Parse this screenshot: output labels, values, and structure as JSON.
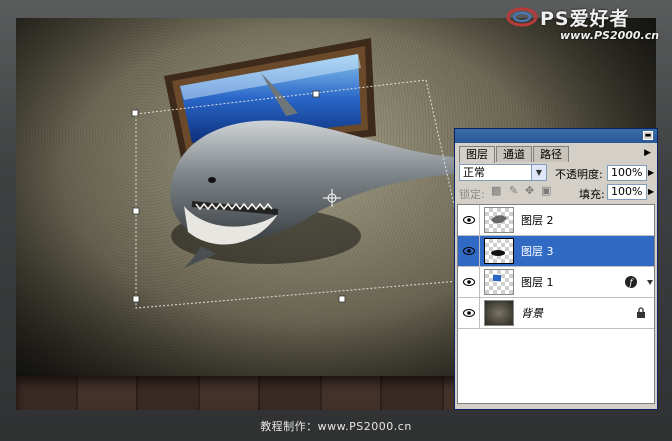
{
  "watermark": {
    "title": "PS爱好者",
    "url": "www.PS2000.cn"
  },
  "footer": {
    "text": "教程制作：www.PS2000.cn"
  },
  "layers_panel": {
    "tabs": [
      "图层",
      "通道",
      "路径"
    ],
    "active_tab": "图层",
    "blend_mode": "正常",
    "opacity_label": "不透明度:",
    "opacity_value": "100%",
    "lock_label": "锁定:",
    "fill_label": "填充:",
    "fill_value": "100%",
    "layers": [
      {
        "name": "图层 2",
        "selected": false
      },
      {
        "name": "图层 3",
        "selected": true
      },
      {
        "name": "图层 1",
        "selected": false
      },
      {
        "name": "背景",
        "selected": false
      }
    ]
  },
  "colors": {
    "selection_blue": "#316ac5",
    "title_blue": "#2b5797",
    "panel_bg": "#d4d0c8"
  },
  "icons": [
    "eye-icon",
    "lock-icon",
    "fx-icon",
    "brush-lock-icon",
    "move-lock-icon",
    "transparency-lock-icon"
  ]
}
